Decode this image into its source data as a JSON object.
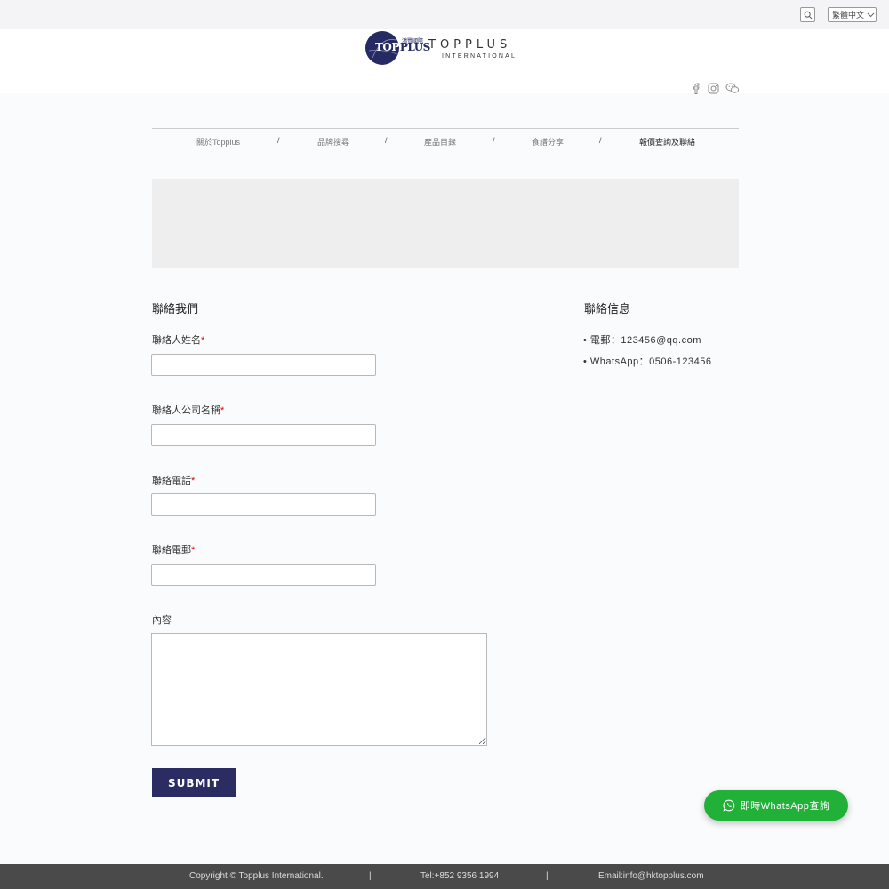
{
  "topbar": {
    "search_icon": "search-icon",
    "language": "繁體中文",
    "language_icon": "chevron-down-icon"
  },
  "logo": {
    "word_top": "TOP",
    "word_plus": "PLUS",
    "chinese": "鴻豐國際",
    "main": "TOPPLUS",
    "sub": "INTERNATIONAL",
    "color": "#262a62"
  },
  "social": [
    "facebook-icon",
    "instagram-icon",
    "wechat-icon"
  ],
  "nav": {
    "items": [
      {
        "label": "關於Topplus"
      },
      {
        "label": "品牌搜尋"
      },
      {
        "label": "產品目錄"
      },
      {
        "label": "食譜分享"
      },
      {
        "label": "報價查詢及聯絡"
      }
    ],
    "separator": "/"
  },
  "form": {
    "title": "聯絡我們",
    "required_mark": "*",
    "fields": [
      {
        "label": "聯絡人姓名",
        "value": "",
        "placeholder": ""
      },
      {
        "label": "聯絡人公司名稱",
        "value": "",
        "placeholder": ""
      },
      {
        "label": "聯絡電話",
        "value": "",
        "placeholder": ""
      },
      {
        "label": "聯絡電郵",
        "value": "",
        "placeholder": ""
      }
    ],
    "content_label": "內容",
    "submit_label": "SUBMIT",
    "submit_color": "#2b2d62"
  },
  "contact_info": {
    "title": "聯絡信息",
    "lines": [
      "• 電郵：123456@qq.com",
      "• WhatsApp：0506-123456"
    ]
  },
  "whatsapp": {
    "label": "即時WhatsApp查詢",
    "color": "#21b038",
    "icon": "whatsapp-icon"
  },
  "footer": {
    "copyright": "Copyright © Topplus International.",
    "tel": "Tel:+852 9356 1994",
    "email": "Email:info@hktopplus.com",
    "separator": "|"
  }
}
